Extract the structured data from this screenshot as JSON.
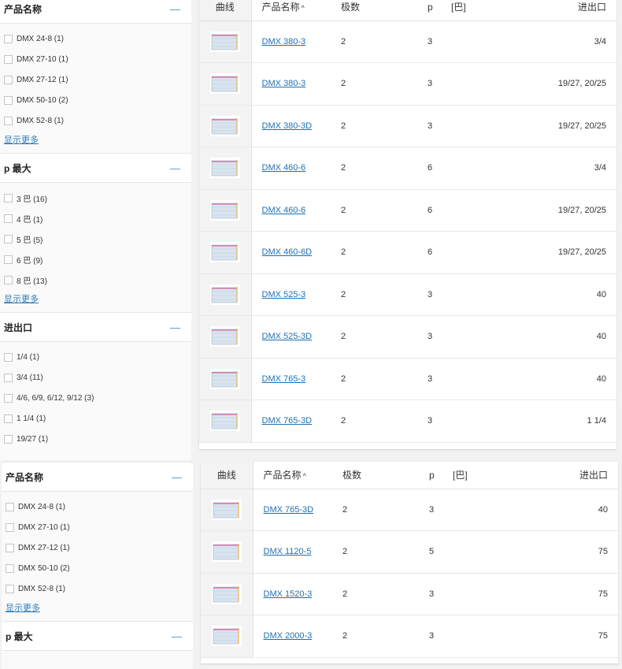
{
  "top": {
    "sidebar": [
      {
        "title": "产品名称",
        "options": [
          "DMX 24-8 (1)",
          "DMX 27-10 (1)",
          "DMX 27-12 (1)",
          "DMX 50-10 (2)",
          "DMX 52-8 (1)"
        ],
        "show_more": "显示更多"
      },
      {
        "title": "p 最大",
        "options": [
          "3 巴 (16)",
          "4 巴 (1)",
          "5 巴 (5)",
          "6 巴 (9)",
          "8 巴 (13)"
        ],
        "show_more": "显示更多"
      },
      {
        "title": "进出口",
        "options": [
          "1/4 (1)",
          "3/4 (11)",
          "4/6, 6/9, 6/12, 9/12 (3)",
          "1 1/4 (1)",
          "19/27 (1)"
        ]
      }
    ],
    "table": {
      "headers": {
        "curve": "曲线",
        "name": "产品名称",
        "sort_caret": "^",
        "poles": "极数",
        "p": "p",
        "bar": "[巴]",
        "port": "进出口"
      },
      "rows": [
        {
          "name": "DMX 380-3",
          "poles": "2",
          "p": "3",
          "port": "3/4"
        },
        {
          "name": "DMX 380-3",
          "poles": "2",
          "p": "3",
          "port": "19/27, 20/25"
        },
        {
          "name": "DMX 380-3D",
          "poles": "2",
          "p": "3",
          "port": "19/27, 20/25"
        },
        {
          "name": "DMX 460-6",
          "poles": "2",
          "p": "6",
          "port": "3/4"
        },
        {
          "name": "DMX 460-6",
          "poles": "2",
          "p": "6",
          "port": "19/27, 20/25"
        },
        {
          "name": "DMX 460-6D",
          "poles": "2",
          "p": "6",
          "port": "19/27, 20/25"
        },
        {
          "name": "DMX 525-3",
          "poles": "2",
          "p": "3",
          "port": "40"
        },
        {
          "name": "DMX 525-3D",
          "poles": "2",
          "p": "3",
          "port": "40"
        },
        {
          "name": "DMX 765-3",
          "poles": "2",
          "p": "3",
          "port": "40"
        },
        {
          "name": "DMX 765-3D",
          "poles": "2",
          "p": "3",
          "port": "1 1/4"
        }
      ]
    }
  },
  "bottom": {
    "sidebar": [
      {
        "title": "产品名称",
        "options": [
          "DMX 24-8 (1)",
          "DMX 27-10 (1)",
          "DMX 27-12 (1)",
          "DMX 50-10 (2)",
          "DMX 52-8 (1)"
        ],
        "show_more": "显示更多"
      },
      {
        "title": "p 最大",
        "options": []
      }
    ],
    "table": {
      "headers": {
        "curve": "曲线",
        "name": "产品名称",
        "sort_caret": "^",
        "poles": "极数",
        "p": "p",
        "bar": "[巴]",
        "port": "进出口"
      },
      "rows": [
        {
          "name": "DMX 765-3D",
          "poles": "2",
          "p": "3",
          "port": "40"
        },
        {
          "name": "DMX 1120-5",
          "poles": "2",
          "p": "5",
          "port": "75"
        },
        {
          "name": "DMX 1520-3",
          "poles": "2",
          "p": "3",
          "port": "75"
        },
        {
          "name": "DMX 2000-3",
          "poles": "2",
          "p": "3",
          "port": "75"
        }
      ]
    }
  }
}
